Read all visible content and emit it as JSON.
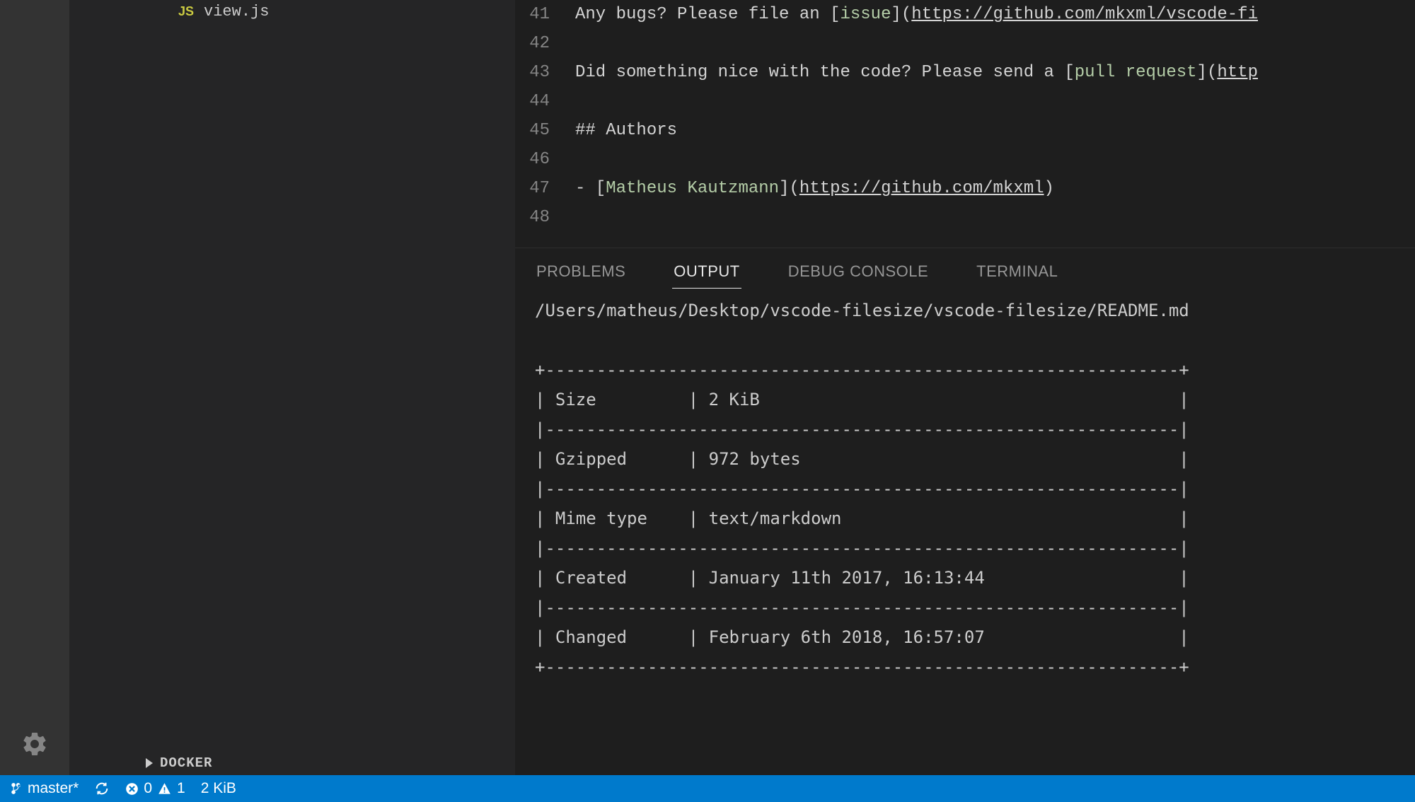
{
  "sidebar": {
    "file": {
      "icon": "JS",
      "label": "view.js"
    },
    "section": {
      "label": "DOCKER"
    }
  },
  "editor": {
    "lines": [
      {
        "num": "41",
        "segments": [
          {
            "t": "Any bugs? Please file an [",
            "c": "tok-text"
          },
          {
            "t": "issue",
            "c": "tok-green"
          },
          {
            "t": "](",
            "c": "tok-text"
          },
          {
            "t": "https://github.com/mkxml/vscode-fi",
            "c": "tok-text tok-underline"
          }
        ]
      },
      {
        "num": "42",
        "segments": []
      },
      {
        "num": "43",
        "segments": [
          {
            "t": "Did something nice with the code? Please send a [",
            "c": "tok-text"
          },
          {
            "t": "pull request",
            "c": "tok-green"
          },
          {
            "t": "](",
            "c": "tok-text"
          },
          {
            "t": "http",
            "c": "tok-text tok-underline"
          }
        ]
      },
      {
        "num": "44",
        "segments": []
      },
      {
        "num": "45",
        "segments": [
          {
            "t": "## Authors",
            "c": "tok-text"
          }
        ]
      },
      {
        "num": "46",
        "segments": []
      },
      {
        "num": "47",
        "segments": [
          {
            "t": "- [",
            "c": "tok-text"
          },
          {
            "t": "Matheus Kautzmann",
            "c": "tok-green"
          },
          {
            "t": "](",
            "c": "tok-text"
          },
          {
            "t": "https://github.com/mkxml",
            "c": "tok-text tok-underline"
          },
          {
            "t": ")",
            "c": "tok-text"
          }
        ]
      },
      {
        "num": "48",
        "segments": []
      }
    ]
  },
  "panel": {
    "tabs": {
      "problems": "PROBLEMS",
      "output": "OUTPUT",
      "debug": "DEBUG CONSOLE",
      "terminal": "TERMINAL"
    },
    "output": {
      "path": "/Users/matheus/Desktop/vscode-filesize/vscode-filesize/README.md",
      "rows": [
        {
          "k": "Size",
          "v": "2 KiB"
        },
        {
          "k": "Gzipped",
          "v": "972 bytes"
        },
        {
          "k": "Mime type",
          "v": "text/markdown"
        },
        {
          "k": "Created",
          "v": "January 11th 2017, 16:13:44"
        },
        {
          "k": "Changed",
          "v": "February 6th 2018, 16:57:07"
        }
      ]
    }
  },
  "status": {
    "branch": "master*",
    "errors": "0",
    "warnings": "1",
    "filesize": "2 KiB"
  }
}
